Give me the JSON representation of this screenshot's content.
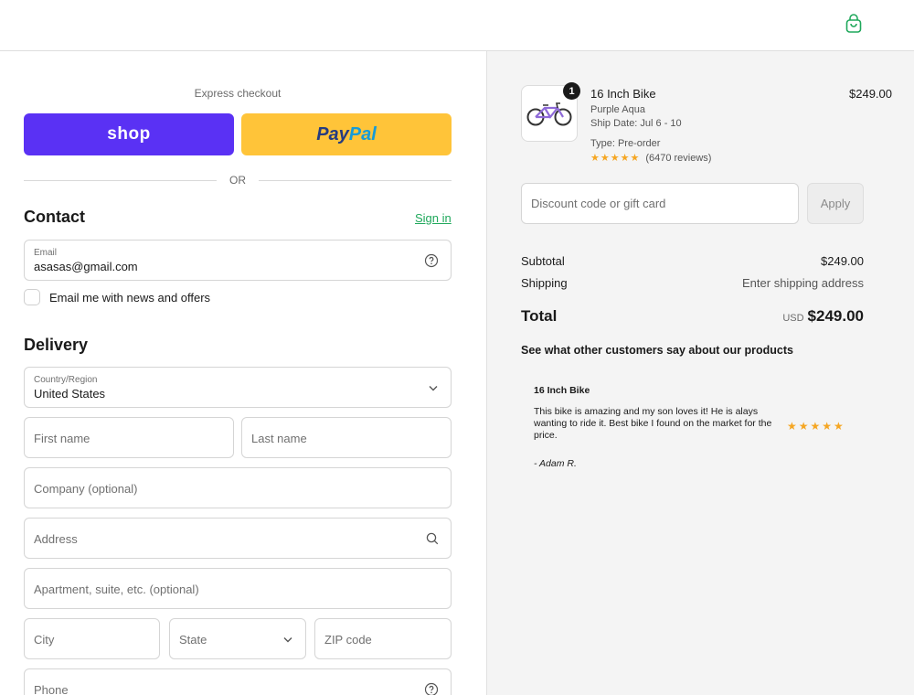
{
  "header": {
    "cart_icon": "shopping-bag-icon",
    "accent": "#1fa85b"
  },
  "express": {
    "title": "Express checkout",
    "shop_label": "shop",
    "paypal_pay": "Pay",
    "paypal_pal": "Pal",
    "or_text": "OR",
    "shop_color": "#5a31f4",
    "paypal_color": "#ffc439"
  },
  "contact": {
    "heading": "Contact",
    "sign_in": "Sign in",
    "email_label": "Email",
    "email_value": "asasas@gmail.com",
    "news_label": "Email me with news and offers"
  },
  "delivery": {
    "heading": "Delivery",
    "country_label": "Country/Region",
    "country_value": "United States",
    "first_name": "First name",
    "last_name": "Last name",
    "company": "Company (optional)",
    "address": "Address",
    "apartment": "Apartment, suite, etc. (optional)",
    "city": "City",
    "state": "State",
    "zip": "ZIP code",
    "phone": "Phone"
  },
  "summary": {
    "product": {
      "quantity": "1",
      "name": "16 Inch Bike",
      "variant": "Purple Aqua",
      "ship_date": "Ship Date: Jul 6 - 10",
      "type": "Type: Pre-order",
      "stars": "★★★★★",
      "reviews": "(6470 reviews)",
      "price": "$249.00"
    },
    "discount_placeholder": "Discount code or gift card",
    "apply_label": "Apply",
    "subtotal_label": "Subtotal",
    "subtotal_value": "$249.00",
    "shipping_label": "Shipping",
    "shipping_value": "Enter shipping address",
    "total_label": "Total",
    "currency": "USD",
    "total_value": "$249.00"
  },
  "reviews_section": {
    "heading": "See what other customers say about our products",
    "review": {
      "title": "16 Inch Bike",
      "body": "This bike is amazing and my son loves it! He is alays wanting to ride it. Best bike I found on the market for the price.",
      "stars": "★★★★★",
      "author": "- Adam R."
    }
  }
}
